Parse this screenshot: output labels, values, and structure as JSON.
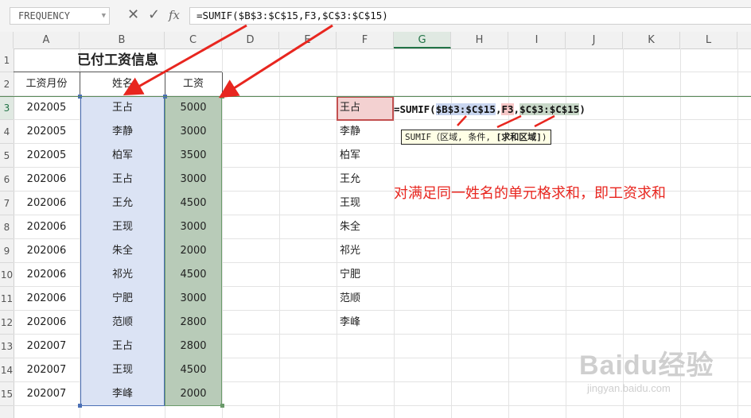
{
  "formula_bar": {
    "name_box": "FREQUENCY",
    "cancel_icon": "cancel-x-icon",
    "enter_icon": "enter-check-icon",
    "fx_label": "fx",
    "formula": "=SUMIF($B$3:$C$15,F3,$C$3:$C$15)"
  },
  "columns": [
    "A",
    "B",
    "C",
    "D",
    "E",
    "F",
    "G",
    "H",
    "I",
    "J",
    "K",
    "L"
  ],
  "rows": [
    "1",
    "2",
    "3",
    "4",
    "5",
    "6",
    "7",
    "8",
    "9",
    "10",
    "11",
    "12",
    "13",
    "14",
    "15"
  ],
  "sheet": {
    "title": "已付工资信息",
    "headers": {
      "a": "工资月份",
      "b": "姓名",
      "c": "工资"
    },
    "data": [
      {
        "month": "202005",
        "name": "王占",
        "salary": "5000"
      },
      {
        "month": "202005",
        "name": "李静",
        "salary": "3000"
      },
      {
        "month": "202005",
        "name": "柏军",
        "salary": "3500"
      },
      {
        "month": "202006",
        "name": "王占",
        "salary": "3000"
      },
      {
        "month": "202006",
        "name": "王允",
        "salary": "4500"
      },
      {
        "month": "202006",
        "name": "王现",
        "salary": "3000"
      },
      {
        "month": "202006",
        "name": "朱全",
        "salary": "2000"
      },
      {
        "month": "202006",
        "name": "祁光",
        "salary": "4500"
      },
      {
        "month": "202006",
        "name": "宁肥",
        "salary": "3000"
      },
      {
        "month": "202006",
        "name": "范顺",
        "salary": "2800"
      },
      {
        "month": "202007",
        "name": "王占",
        "salary": "2800"
      },
      {
        "month": "202007",
        "name": "王现",
        "salary": "4500"
      },
      {
        "month": "202007",
        "name": "李峰",
        "salary": "2000"
      }
    ],
    "f_names": [
      "王占",
      "李静",
      "柏军",
      "王允",
      "王现",
      "朱全",
      "祁光",
      "宁肥",
      "范顺",
      "李峰"
    ]
  },
  "edit": {
    "prefix": "=SUMIF(",
    "arg1": "$B$3:$C$15",
    "sep1": ",",
    "arg2": "F3",
    "sep2": ",",
    "arg3": "$C$3:$C$15",
    "suffix": ")"
  },
  "tooltip": {
    "fn": "SUMIF",
    "params": "（区域, 条件, ",
    "bold_param": "[求和区域]",
    "close": ")"
  },
  "annotation": "对满足同一姓名的单元格求和，即工资求和",
  "watermark": {
    "main": "Baidu经验",
    "sub": "jingyan.baidu.com"
  },
  "colors": {
    "arrow": "#e8261f",
    "b_range": "#dbe3f4",
    "c_range": "#b8cbb8",
    "active_cell": "#f3d1d1",
    "header_active": "#217346"
  }
}
